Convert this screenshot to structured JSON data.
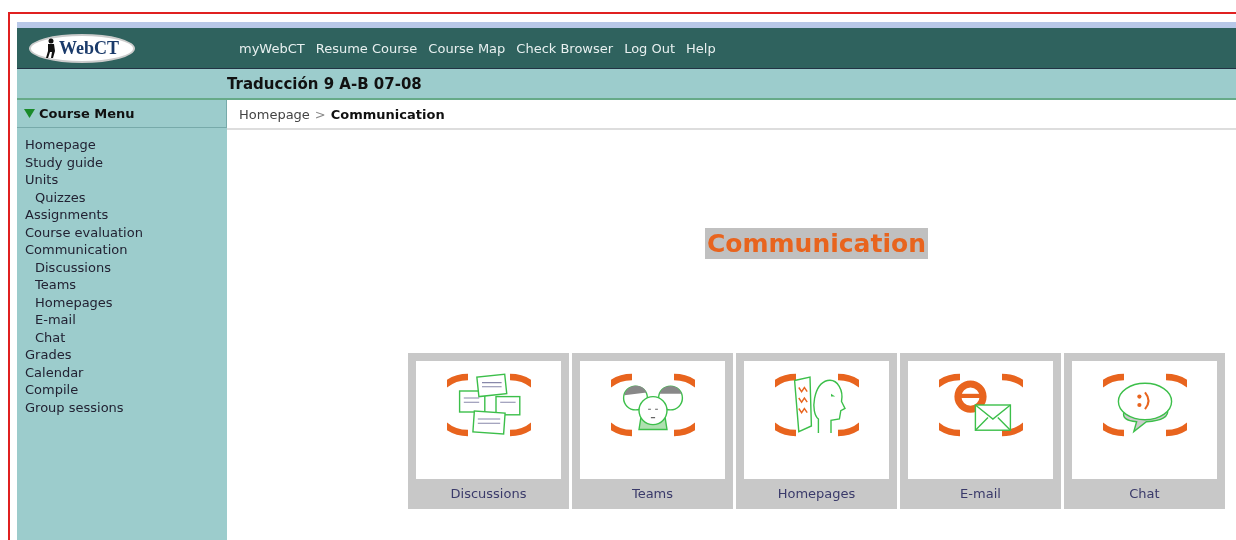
{
  "logo": {
    "text": "WebCT"
  },
  "top_nav": [
    {
      "label": "myWebCT"
    },
    {
      "label": "Resume Course"
    },
    {
      "label": "Course Map"
    },
    {
      "label": "Check Browser"
    },
    {
      "label": "Log Out"
    },
    {
      "label": "Help"
    }
  ],
  "course_title": "Traducción 9 A-B 07-08",
  "sidebar": {
    "title": "Course Menu",
    "expanded": true,
    "items": [
      {
        "label": "Homepage"
      },
      {
        "label": "Study guide"
      },
      {
        "label": "Units",
        "children": [
          {
            "label": "Quizzes"
          }
        ]
      },
      {
        "label": "Assignments"
      },
      {
        "label": "Course evaluation"
      },
      {
        "label": "Communication",
        "children": [
          {
            "label": "Discussions"
          },
          {
            "label": "Teams"
          },
          {
            "label": "Homepages"
          },
          {
            "label": "E-mail"
          },
          {
            "label": "Chat"
          }
        ]
      },
      {
        "label": "Grades"
      },
      {
        "label": "Calendar"
      },
      {
        "label": "Compile"
      },
      {
        "label": "Group sessions"
      }
    ]
  },
  "breadcrumb": {
    "parent": "Homepage",
    "separator": ">",
    "current": "Communication"
  },
  "heading": "Communication",
  "tools": [
    {
      "label": "Discussions"
    },
    {
      "label": "Teams"
    },
    {
      "label": "Homepages"
    },
    {
      "label": "E-mail"
    },
    {
      "label": "Chat"
    }
  ]
}
